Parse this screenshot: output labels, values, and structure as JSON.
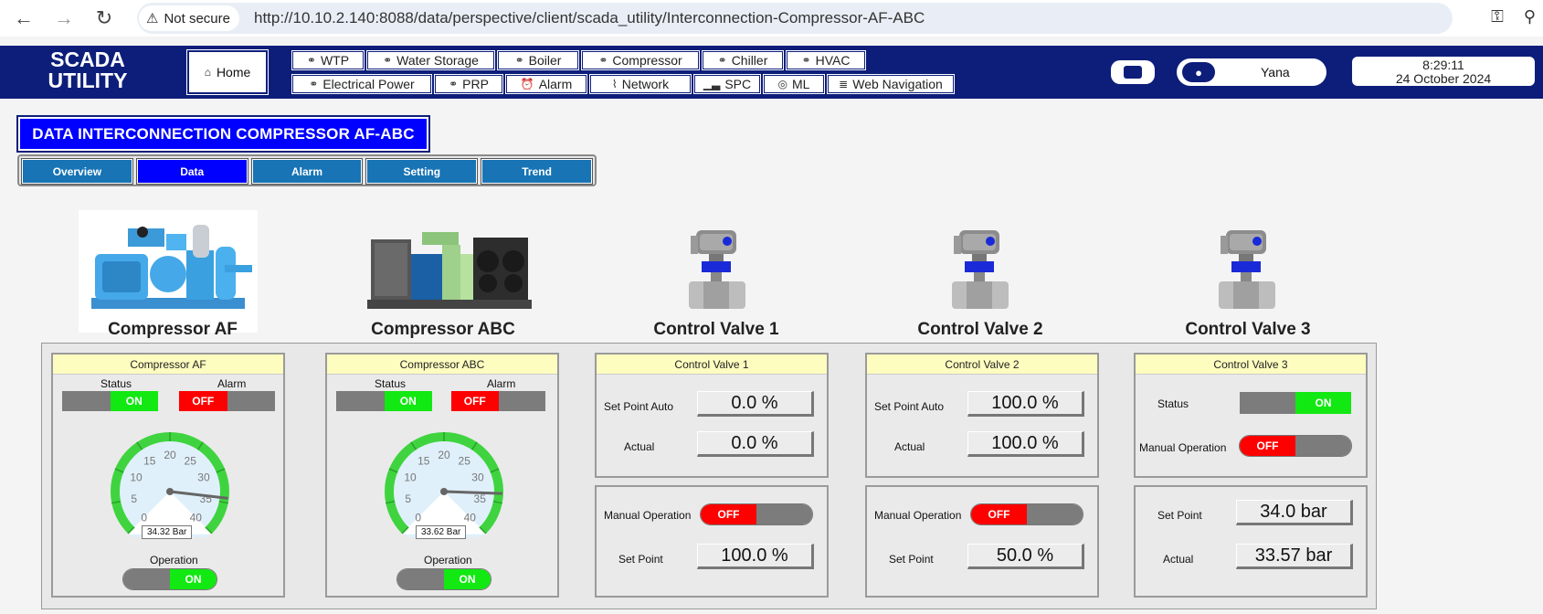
{
  "browser": {
    "security_label": "Not secure",
    "url": "http://10.10.2.140:8088/data/perspective/client/scada_utility/Interconnection-Compressor-AF-ABC"
  },
  "header": {
    "logo_line1": "SCADA",
    "logo_line2": "UTILITY",
    "home_label": "Home",
    "menu_row1": [
      {
        "label": "WTP",
        "icon": "link-icon"
      },
      {
        "label": "Water Storage",
        "icon": "link-icon"
      },
      {
        "label": "Boiler",
        "icon": "link-icon"
      },
      {
        "label": "Compressor",
        "icon": "link-icon"
      },
      {
        "label": "Chiller",
        "icon": "link-icon"
      },
      {
        "label": "HVAC",
        "icon": "link-icon"
      }
    ],
    "menu_row2": [
      {
        "label": "Electrical Power",
        "icon": "link-icon"
      },
      {
        "label": "PRP",
        "icon": "link-icon"
      },
      {
        "label": "Alarm",
        "icon": "alarm-clock-icon"
      },
      {
        "label": "Network",
        "icon": "wifi-icon"
      },
      {
        "label": "SPC",
        "icon": "bar-chart-icon"
      },
      {
        "label": "ML",
        "icon": "globe-icon"
      },
      {
        "label": "Web Navigation",
        "icon": "document-icon"
      }
    ],
    "user_name": "Yana",
    "time": "8:29:11",
    "date": "24 October 2024"
  },
  "page": {
    "title": "DATA INTERCONNECTION COMPRESSOR AF-ABC",
    "tabs": [
      "Overview",
      "Data",
      "Alarm",
      "Setting",
      "Trend"
    ],
    "active_tab": "Data"
  },
  "equipment": {
    "compressor_af": "Compressor AF",
    "compressor_abc": "Compressor ABC",
    "valve1": "Control Valve 1",
    "valve2": "Control Valve 2",
    "valve3": "Control Valve 3"
  },
  "panels": {
    "comp_af": {
      "title": "Compressor AF",
      "status_label": "Status",
      "status_value": "ON",
      "alarm_label": "Alarm",
      "alarm_value": "OFF",
      "gauge_value": 34.32,
      "gauge_min": 0,
      "gauge_max": 40,
      "gauge_readout": "34.32 Bar",
      "operation_label": "Operation",
      "operation_value": "ON"
    },
    "comp_abc": {
      "title": "Compressor ABC",
      "status_label": "Status",
      "status_value": "ON",
      "alarm_label": "Alarm",
      "alarm_value": "OFF",
      "gauge_value": 33.62,
      "gauge_min": 0,
      "gauge_max": 40,
      "gauge_readout": "33.62 Bar",
      "operation_label": "Operation",
      "operation_value": "ON"
    },
    "valve1": {
      "title": "Control Valve 1",
      "sp_auto_label": "Set Point Auto",
      "sp_auto_value": "0.0 %",
      "actual_label": "Actual",
      "actual_value": "0.0 %",
      "manual_label": "Manual Operation",
      "manual_value": "OFF",
      "sp_label": "Set Point",
      "sp_value": "100.0 %"
    },
    "valve2": {
      "title": "Control Valve 2",
      "sp_auto_label": "Set Point Auto",
      "sp_auto_value": "100.0 %",
      "actual_label": "Actual",
      "actual_value": "100.0 %",
      "manual_label": "Manual Operation",
      "manual_value": "OFF",
      "sp_label": "Set Point",
      "sp_value": "50.0 %"
    },
    "valve3": {
      "title": "Control Valve 3",
      "status_label": "Status",
      "status_value": "ON",
      "manual_label": "Manual Operation",
      "manual_value": "OFF",
      "sp_label": "Set Point",
      "sp_value": "34.0 bar",
      "actual_label": "Actual",
      "actual_value": "33.57 bar"
    }
  },
  "gauge_ticks": [
    "0",
    "5",
    "10",
    "15",
    "20",
    "25",
    "30",
    "35",
    "40"
  ],
  "colors": {
    "header_bg": "#0d1e7a",
    "on_green": "#12e812",
    "off_red": "#ff0000",
    "tab_blue": "#1874b5",
    "active_blue": "#0000ff",
    "panel_title_bg": "#fdfdbf"
  }
}
